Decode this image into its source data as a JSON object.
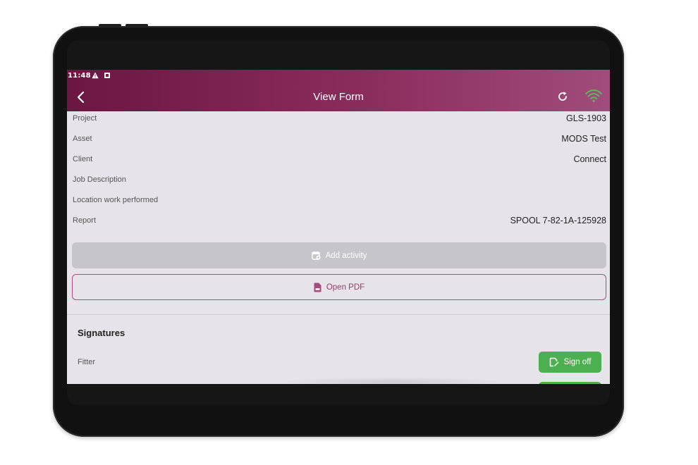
{
  "status_bar": {
    "time": "11:48",
    "icons": [
      "warning-icon",
      "notification-icon"
    ]
  },
  "app_bar": {
    "title": "View Form",
    "back_icon": "chevron-left-icon",
    "refresh_icon": "refresh-icon",
    "wifi_icon": "wifi-icon",
    "wifi_color": "#5cb85c"
  },
  "form": {
    "rows": [
      {
        "label": "Project",
        "value": "GLS-1903"
      },
      {
        "label": "Asset",
        "value": "MODS Test"
      },
      {
        "label": "Client",
        "value": "Connect"
      },
      {
        "label": "Job Description",
        "value": ""
      },
      {
        "label": "Location work performed",
        "value": ""
      },
      {
        "label": "Report",
        "value": "SPOOL 7-82-1A-125928"
      }
    ]
  },
  "actions": {
    "add_activity_label": "Add activity",
    "open_pdf_label": "Open PDF"
  },
  "signatures": {
    "title": "Signatures",
    "items": [
      {
        "label": "Fitter",
        "button_label": "Sign off"
      }
    ]
  },
  "colors": {
    "accent": "#8a2d5d",
    "success": "#4caf50",
    "background": "#e6e4e9"
  }
}
